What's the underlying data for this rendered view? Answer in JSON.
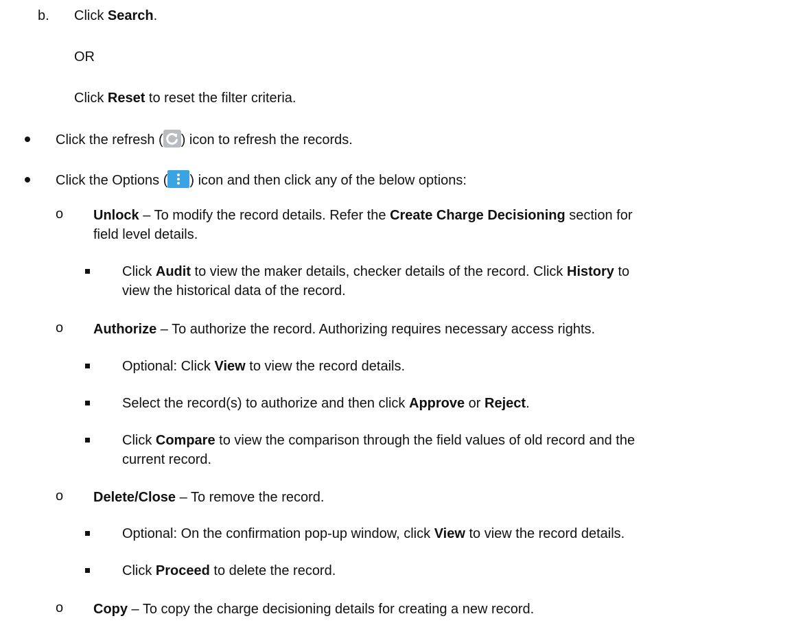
{
  "step_b": {
    "prefix": "b.",
    "text1": "Click ",
    "bold": "Search",
    "text2": "."
  },
  "or_text": "OR",
  "reset_line": {
    "text1": "Click ",
    "bold": "Reset",
    "text2": " to reset the filter criteria."
  },
  "refresh_line": {
    "text1": "Click the refresh (",
    "text2": ") icon to refresh the records.",
    "icon": "refresh-icon"
  },
  "options_line": {
    "text1": "Click the Options (",
    "text2": ") icon and then click any of the below options:",
    "icon": "options-kebab-icon"
  },
  "unlock": {
    "bold1": "Unlock",
    "text1": " – To modify the record details. Refer the ",
    "bold2": "Create Charge Decisioning",
    "text2": " section for",
    "cont": "field level details."
  },
  "audit": {
    "text1": "Click ",
    "bold1": "Audit",
    "text2": " to view the maker details, checker details of the record. Click ",
    "bold2": "History",
    "text3": " to",
    "cont": "view the historical data of the record."
  },
  "authorize": {
    "bold1": "Authorize",
    "text1": " – To authorize the record. Authorizing requires necessary access rights."
  },
  "auth_view": {
    "text1": "Optional: Click ",
    "bold1": "View",
    "text2": " to view the record details."
  },
  "auth_select": {
    "text1": "Select the record(s) to authorize and then click ",
    "bold1": "Approve",
    "text2": " or ",
    "bold2": "Reject",
    "text3": "."
  },
  "auth_compare": {
    "text1": "Click ",
    "bold1": "Compare",
    "text2": " to view the comparison through the field values of old record and the",
    "cont": "current record."
  },
  "delete": {
    "bold1": "Delete/Close",
    "text1": " – To remove the record."
  },
  "delete_view": {
    "text1": "Optional: On the confirmation pop-up window, click ",
    "bold1": "View",
    "text2": " to view the record details."
  },
  "delete_proceed": {
    "text1": "Click ",
    "bold1": "Proceed",
    "text2": " to delete the record."
  },
  "copy": {
    "bold1": "Copy",
    "text1": " – To copy the charge decisioning details for creating a new record."
  },
  "colors": {
    "text": "#111111",
    "refresh_icon_bg": "#b9bcc0",
    "options_icon_bg": "#3aa3e3"
  }
}
